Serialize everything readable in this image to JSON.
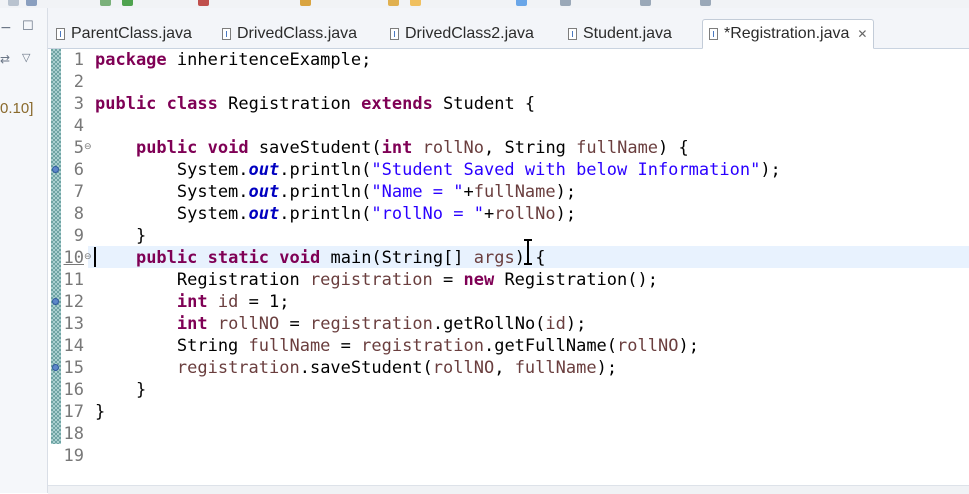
{
  "left_panel": {
    "version_text": "0.10]"
  },
  "tabs": [
    {
      "label": "ParentClass.java",
      "active": false
    },
    {
      "label": "DrivedClass.java",
      "active": false
    },
    {
      "label": "DrivedClass2.java",
      "active": false
    },
    {
      "label": "Student.java",
      "active": false
    },
    {
      "label": "*Registration.java",
      "active": true
    }
  ],
  "tab_close_glyph": "✕",
  "editor": {
    "current_line": 10,
    "lines": [
      {
        "num": "1",
        "tokens": [
          {
            "t": "package",
            "c": "kw"
          },
          {
            "t": " inheritenceExample;",
            "c": ""
          }
        ]
      },
      {
        "num": "2",
        "tokens": []
      },
      {
        "num": "3",
        "tokens": [
          {
            "t": "public",
            "c": "kw"
          },
          {
            "t": " ",
            "c": ""
          },
          {
            "t": "class",
            "c": "kw"
          },
          {
            "t": " Registration ",
            "c": ""
          },
          {
            "t": "extends",
            "c": "kw"
          },
          {
            "t": " Student {",
            "c": ""
          }
        ]
      },
      {
        "num": "4",
        "tokens": []
      },
      {
        "num": "5",
        "fold": true,
        "tokens": [
          {
            "t": "    ",
            "c": ""
          },
          {
            "t": "public",
            "c": "kw"
          },
          {
            "t": " ",
            "c": ""
          },
          {
            "t": "void",
            "c": "kw"
          },
          {
            "t": " saveStudent(",
            "c": ""
          },
          {
            "t": "int",
            "c": "kw"
          },
          {
            "t": " ",
            "c": ""
          },
          {
            "t": "rollNo",
            "c": "par"
          },
          {
            "t": ", String ",
            "c": ""
          },
          {
            "t": "fullName",
            "c": "par"
          },
          {
            "t": ") {",
            "c": ""
          }
        ]
      },
      {
        "num": "6",
        "marker": true,
        "tokens": [
          {
            "t": "        System.",
            "c": ""
          },
          {
            "t": "out",
            "c": "fld"
          },
          {
            "t": ".println(",
            "c": ""
          },
          {
            "t": "\"Student Saved with below Information\"",
            "c": "str"
          },
          {
            "t": ");",
            "c": ""
          }
        ]
      },
      {
        "num": "7",
        "tokens": [
          {
            "t": "        System.",
            "c": ""
          },
          {
            "t": "out",
            "c": "fld"
          },
          {
            "t": ".println(",
            "c": ""
          },
          {
            "t": "\"Name = \"",
            "c": "str"
          },
          {
            "t": "+",
            "c": ""
          },
          {
            "t": "fullName",
            "c": "par"
          },
          {
            "t": ");",
            "c": ""
          }
        ]
      },
      {
        "num": "8",
        "tokens": [
          {
            "t": "        System.",
            "c": ""
          },
          {
            "t": "out",
            "c": "fld"
          },
          {
            "t": ".println(",
            "c": ""
          },
          {
            "t": "\"rollNo = \"",
            "c": "str"
          },
          {
            "t": "+",
            "c": ""
          },
          {
            "t": "rollNo",
            "c": "par"
          },
          {
            "t": ");",
            "c": ""
          }
        ]
      },
      {
        "num": "9",
        "tokens": [
          {
            "t": "    }",
            "c": ""
          }
        ]
      },
      {
        "num": "10",
        "fold": true,
        "tokens": [
          {
            "t": "    ",
            "c": ""
          },
          {
            "t": "public",
            "c": "kw"
          },
          {
            "t": " ",
            "c": ""
          },
          {
            "t": "static",
            "c": "kw"
          },
          {
            "t": " ",
            "c": ""
          },
          {
            "t": "void",
            "c": "kw"
          },
          {
            "t": " main(String[] ",
            "c": ""
          },
          {
            "t": "args",
            "c": "par"
          },
          {
            "t": ") {",
            "c": ""
          }
        ]
      },
      {
        "num": "11",
        "tokens": [
          {
            "t": "        Registration ",
            "c": ""
          },
          {
            "t": "registration",
            "c": "par"
          },
          {
            "t": " = ",
            "c": ""
          },
          {
            "t": "new",
            "c": "kw"
          },
          {
            "t": " Registration();",
            "c": ""
          }
        ]
      },
      {
        "num": "12",
        "marker": true,
        "tokens": [
          {
            "t": "        ",
            "c": ""
          },
          {
            "t": "int",
            "c": "kw"
          },
          {
            "t": " ",
            "c": ""
          },
          {
            "t": "id",
            "c": "par"
          },
          {
            "t": " = 1;",
            "c": ""
          }
        ]
      },
      {
        "num": "13",
        "tokens": [
          {
            "t": "        ",
            "c": ""
          },
          {
            "t": "int",
            "c": "kw"
          },
          {
            "t": " ",
            "c": ""
          },
          {
            "t": "rollNO",
            "c": "par"
          },
          {
            "t": " = ",
            "c": ""
          },
          {
            "t": "registration",
            "c": "par"
          },
          {
            "t": ".getRollNo(",
            "c": ""
          },
          {
            "t": "id",
            "c": "par"
          },
          {
            "t": ");",
            "c": ""
          }
        ]
      },
      {
        "num": "14",
        "tokens": [
          {
            "t": "        String ",
            "c": ""
          },
          {
            "t": "fullName",
            "c": "par"
          },
          {
            "t": " = ",
            "c": ""
          },
          {
            "t": "registration",
            "c": "par"
          },
          {
            "t": ".getFullName(",
            "c": ""
          },
          {
            "t": "rollNO",
            "c": "par"
          },
          {
            "t": ");",
            "c": ""
          }
        ]
      },
      {
        "num": "15",
        "marker": true,
        "tokens": [
          {
            "t": "        ",
            "c": ""
          },
          {
            "t": "registration",
            "c": "par"
          },
          {
            "t": ".saveStudent(",
            "c": ""
          },
          {
            "t": "rollNO",
            "c": "par"
          },
          {
            "t": ", ",
            "c": ""
          },
          {
            "t": "fullName",
            "c": "par"
          },
          {
            "t": ");",
            "c": ""
          }
        ]
      },
      {
        "num": "16",
        "tokens": [
          {
            "t": "    }",
            "c": ""
          }
        ]
      },
      {
        "num": "17",
        "tokens": [
          {
            "t": "}",
            "c": ""
          }
        ]
      },
      {
        "num": "18",
        "tokens": []
      },
      {
        "num": "19",
        "tokens": []
      }
    ]
  },
  "colors": {
    "keyword": "#7f0055",
    "string": "#2a00ff",
    "field": "#0000c0",
    "parameter": "#6a3e3e",
    "current_line": "#e8f2fe"
  }
}
